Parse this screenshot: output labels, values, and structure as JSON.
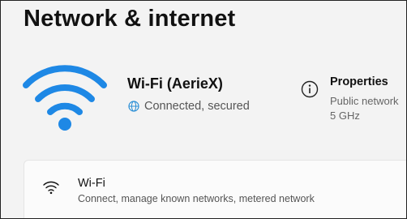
{
  "page": {
    "title": "Network & internet"
  },
  "hero": {
    "network_name": "Wi-Fi (AerieX)",
    "status": "Connected, secured",
    "wifi_icon": "wifi-icon",
    "status_icon": "globe-icon",
    "accent_color": "#1e88e5"
  },
  "properties": {
    "title": "Properties",
    "network_type": "Public network",
    "band": "5 GHz",
    "icon": "info-icon"
  },
  "cards": [
    {
      "title": "Wi-Fi",
      "subtitle": "Connect, manage known networks, metered network",
      "icon": "wifi-icon"
    }
  ]
}
